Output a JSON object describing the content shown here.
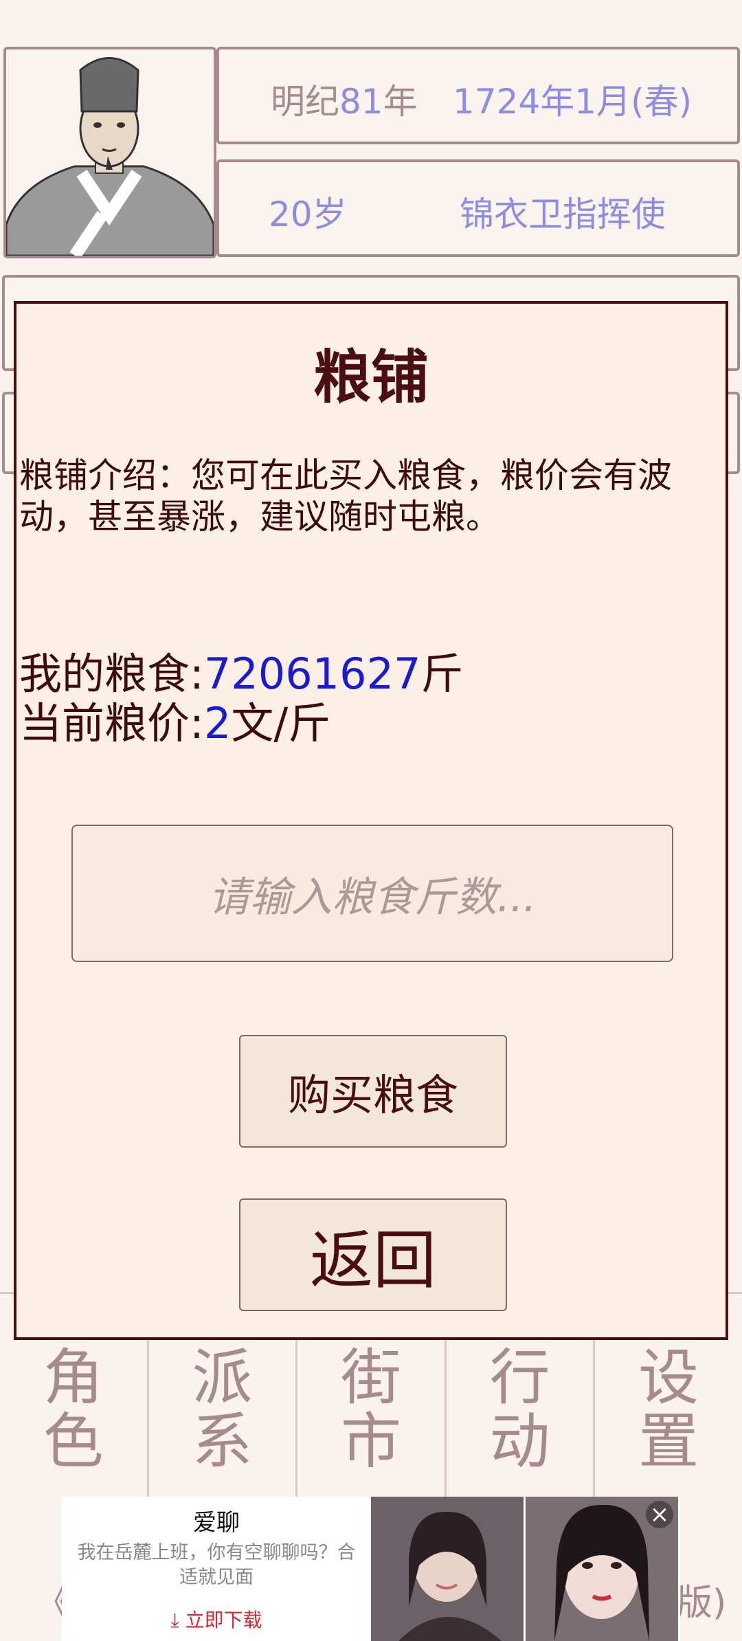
{
  "header": {
    "era": "明纪",
    "era_year": "81",
    "era_year_suffix": "年",
    "date": "1724年1月(春)",
    "age": "20岁",
    "title": "锦衣卫指挥使"
  },
  "dialog": {
    "title": "粮铺",
    "intro": "粮铺介绍：您可在此买入粮食，粮价会有波动，甚至暴涨，建议随时屯粮。",
    "grain_label": "我的粮食:",
    "grain_value": "72061627",
    "grain_unit": "斤",
    "price_label": "当前粮价:",
    "price_value": "2",
    "price_unit": "文/斤",
    "input_placeholder": "请输入粮食斤数...",
    "buy_label": "购买粮食",
    "back_label": "返回"
  },
  "nav": {
    "items": [
      {
        "c1": "角",
        "c2": "色"
      },
      {
        "c1": "派",
        "c2": "系"
      },
      {
        "c1": "街",
        "c2": "市"
      },
      {
        "c1": "行",
        "c2": "动"
      },
      {
        "c1": "设",
        "c2": "置"
      }
    ]
  },
  "ad": {
    "title": "爱聊",
    "desc_line1": "我在岳麓上班，你有空聊聊吗？合",
    "desc_line2": "适就见面",
    "download": "立即下载"
  },
  "footer": {
    "left": "《",
    "right": "版)"
  }
}
